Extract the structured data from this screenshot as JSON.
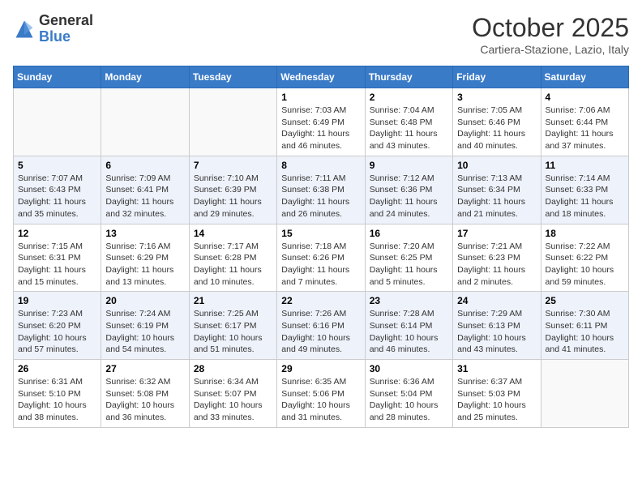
{
  "header": {
    "logo_general": "General",
    "logo_blue": "Blue",
    "month_title": "October 2025",
    "subtitle": "Cartiera-Stazione, Lazio, Italy"
  },
  "days_of_week": [
    "Sunday",
    "Monday",
    "Tuesday",
    "Wednesday",
    "Thursday",
    "Friday",
    "Saturday"
  ],
  "weeks": [
    [
      {
        "day": "",
        "info": ""
      },
      {
        "day": "",
        "info": ""
      },
      {
        "day": "",
        "info": ""
      },
      {
        "day": "1",
        "info": "Sunrise: 7:03 AM\nSunset: 6:49 PM\nDaylight: 11 hours and 46 minutes."
      },
      {
        "day": "2",
        "info": "Sunrise: 7:04 AM\nSunset: 6:48 PM\nDaylight: 11 hours and 43 minutes."
      },
      {
        "day": "3",
        "info": "Sunrise: 7:05 AM\nSunset: 6:46 PM\nDaylight: 11 hours and 40 minutes."
      },
      {
        "day": "4",
        "info": "Sunrise: 7:06 AM\nSunset: 6:44 PM\nDaylight: 11 hours and 37 minutes."
      }
    ],
    [
      {
        "day": "5",
        "info": "Sunrise: 7:07 AM\nSunset: 6:43 PM\nDaylight: 11 hours and 35 minutes."
      },
      {
        "day": "6",
        "info": "Sunrise: 7:09 AM\nSunset: 6:41 PM\nDaylight: 11 hours and 32 minutes."
      },
      {
        "day": "7",
        "info": "Sunrise: 7:10 AM\nSunset: 6:39 PM\nDaylight: 11 hours and 29 minutes."
      },
      {
        "day": "8",
        "info": "Sunrise: 7:11 AM\nSunset: 6:38 PM\nDaylight: 11 hours and 26 minutes."
      },
      {
        "day": "9",
        "info": "Sunrise: 7:12 AM\nSunset: 6:36 PM\nDaylight: 11 hours and 24 minutes."
      },
      {
        "day": "10",
        "info": "Sunrise: 7:13 AM\nSunset: 6:34 PM\nDaylight: 11 hours and 21 minutes."
      },
      {
        "day": "11",
        "info": "Sunrise: 7:14 AM\nSunset: 6:33 PM\nDaylight: 11 hours and 18 minutes."
      }
    ],
    [
      {
        "day": "12",
        "info": "Sunrise: 7:15 AM\nSunset: 6:31 PM\nDaylight: 11 hours and 15 minutes."
      },
      {
        "day": "13",
        "info": "Sunrise: 7:16 AM\nSunset: 6:29 PM\nDaylight: 11 hours and 13 minutes."
      },
      {
        "day": "14",
        "info": "Sunrise: 7:17 AM\nSunset: 6:28 PM\nDaylight: 11 hours and 10 minutes."
      },
      {
        "day": "15",
        "info": "Sunrise: 7:18 AM\nSunset: 6:26 PM\nDaylight: 11 hours and 7 minutes."
      },
      {
        "day": "16",
        "info": "Sunrise: 7:20 AM\nSunset: 6:25 PM\nDaylight: 11 hours and 5 minutes."
      },
      {
        "day": "17",
        "info": "Sunrise: 7:21 AM\nSunset: 6:23 PM\nDaylight: 11 hours and 2 minutes."
      },
      {
        "day": "18",
        "info": "Sunrise: 7:22 AM\nSunset: 6:22 PM\nDaylight: 10 hours and 59 minutes."
      }
    ],
    [
      {
        "day": "19",
        "info": "Sunrise: 7:23 AM\nSunset: 6:20 PM\nDaylight: 10 hours and 57 minutes."
      },
      {
        "day": "20",
        "info": "Sunrise: 7:24 AM\nSunset: 6:19 PM\nDaylight: 10 hours and 54 minutes."
      },
      {
        "day": "21",
        "info": "Sunrise: 7:25 AM\nSunset: 6:17 PM\nDaylight: 10 hours and 51 minutes."
      },
      {
        "day": "22",
        "info": "Sunrise: 7:26 AM\nSunset: 6:16 PM\nDaylight: 10 hours and 49 minutes."
      },
      {
        "day": "23",
        "info": "Sunrise: 7:28 AM\nSunset: 6:14 PM\nDaylight: 10 hours and 46 minutes."
      },
      {
        "day": "24",
        "info": "Sunrise: 7:29 AM\nSunset: 6:13 PM\nDaylight: 10 hours and 43 minutes."
      },
      {
        "day": "25",
        "info": "Sunrise: 7:30 AM\nSunset: 6:11 PM\nDaylight: 10 hours and 41 minutes."
      }
    ],
    [
      {
        "day": "26",
        "info": "Sunrise: 6:31 AM\nSunset: 5:10 PM\nDaylight: 10 hours and 38 minutes."
      },
      {
        "day": "27",
        "info": "Sunrise: 6:32 AM\nSunset: 5:08 PM\nDaylight: 10 hours and 36 minutes."
      },
      {
        "day": "28",
        "info": "Sunrise: 6:34 AM\nSunset: 5:07 PM\nDaylight: 10 hours and 33 minutes."
      },
      {
        "day": "29",
        "info": "Sunrise: 6:35 AM\nSunset: 5:06 PM\nDaylight: 10 hours and 31 minutes."
      },
      {
        "day": "30",
        "info": "Sunrise: 6:36 AM\nSunset: 5:04 PM\nDaylight: 10 hours and 28 minutes."
      },
      {
        "day": "31",
        "info": "Sunrise: 6:37 AM\nSunset: 5:03 PM\nDaylight: 10 hours and 25 minutes."
      },
      {
        "day": "",
        "info": ""
      }
    ]
  ]
}
